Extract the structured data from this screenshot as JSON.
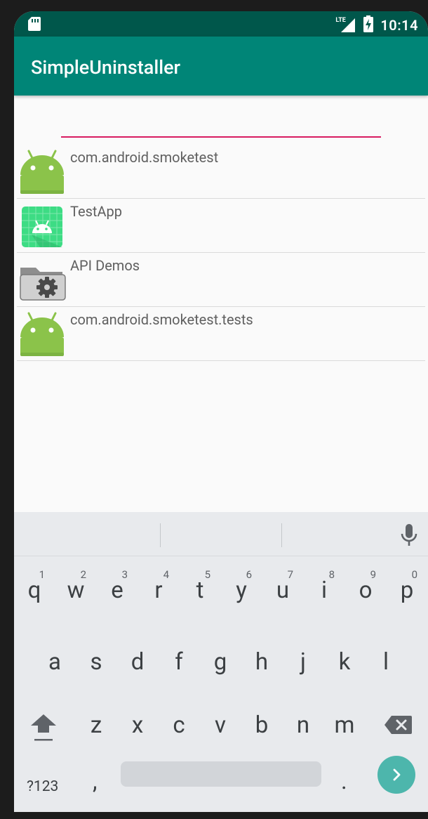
{
  "status_bar": {
    "time": "10:14",
    "network": "LTE"
  },
  "app_bar": {
    "title": "SimpleUninstaller"
  },
  "search": {
    "value": "",
    "placeholder": ""
  },
  "apps": [
    {
      "label": "com.android.smoketest",
      "icon": "android-robot-icon"
    },
    {
      "label": "TestApp",
      "icon": "android-grid-icon"
    },
    {
      "label": "API Demos",
      "icon": "folder-gear-icon"
    },
    {
      "label": "com.android.smoketest.tests",
      "icon": "android-robot-icon"
    }
  ],
  "keyboard": {
    "row1": [
      {
        "key": "q",
        "hint": "1"
      },
      {
        "key": "w",
        "hint": "2"
      },
      {
        "key": "e",
        "hint": "3"
      },
      {
        "key": "r",
        "hint": "4"
      },
      {
        "key": "t",
        "hint": "5"
      },
      {
        "key": "y",
        "hint": "6"
      },
      {
        "key": "u",
        "hint": "7"
      },
      {
        "key": "i",
        "hint": "8"
      },
      {
        "key": "o",
        "hint": "9"
      },
      {
        "key": "p",
        "hint": "0"
      }
    ],
    "row2": [
      "a",
      "s",
      "d",
      "f",
      "g",
      "h",
      "j",
      "k",
      "l"
    ],
    "row3": [
      "z",
      "x",
      "c",
      "v",
      "b",
      "n",
      "m"
    ],
    "symbols_label": "?123",
    "comma": ",",
    "period": "."
  },
  "colors": {
    "primary": "#008577",
    "primary_dark": "#00574B",
    "accent": "#D81B60",
    "go_key": "#4DB6AC"
  }
}
